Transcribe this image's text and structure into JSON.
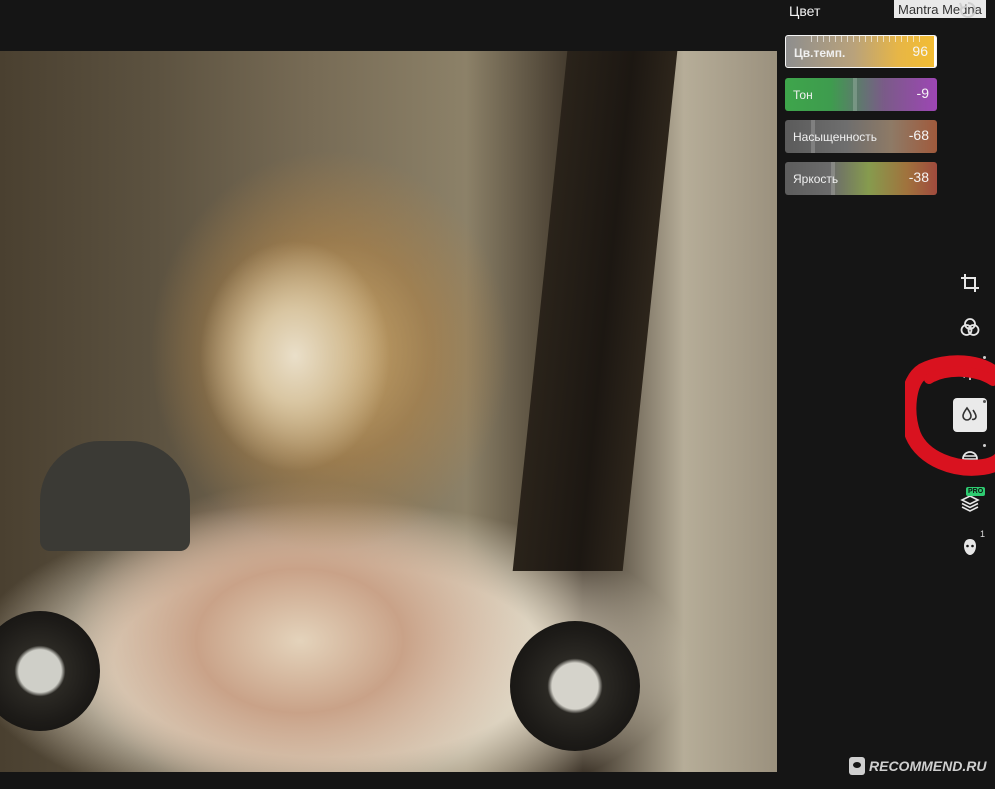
{
  "panel": {
    "title": "Цвет"
  },
  "overlay": {
    "user_label": "Mantra Medna"
  },
  "sliders": [
    {
      "label": "Цв.темп.",
      "value": "96",
      "active": true
    },
    {
      "label": "Тон",
      "value": "-9",
      "active": false
    },
    {
      "label": "Насыщенность",
      "value": "-68",
      "active": false
    },
    {
      "label": "Яркость",
      "value": "-38",
      "active": false
    }
  ],
  "toolbar": {
    "items": [
      {
        "icon": "crop-icon"
      },
      {
        "icon": "filters-icon"
      },
      {
        "icon": "adjust-sun-icon"
      },
      {
        "icon": "color-drops-icon",
        "active": true
      },
      {
        "icon": "hsl-ball-icon"
      },
      {
        "icon": "layers-icon",
        "badge": "PRO"
      },
      {
        "icon": "face-retouch-icon",
        "badge": "1"
      }
    ]
  },
  "footer": {
    "watermark": "RECOMMEND.RU"
  },
  "colors": {
    "background": "#151515",
    "accent_temp": "#f3bd32",
    "tone_green": "#3ea54b",
    "tone_purple": "#9d46b4",
    "annotation_red": "#d9121f",
    "pro_badge": "#2ecc71"
  }
}
